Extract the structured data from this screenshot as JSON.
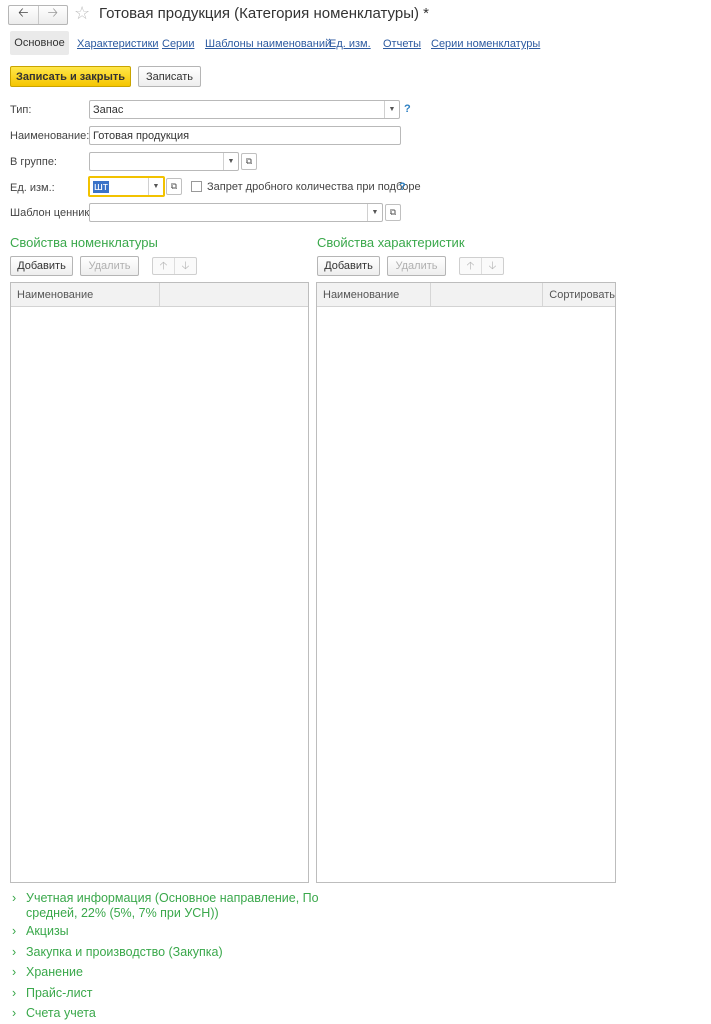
{
  "window": {
    "title": "Готовая продукция (Категория номенклатуры) *",
    "back_icon": "arrow-left",
    "forward_icon": "arrow-right",
    "favorite_icon": "star-outline"
  },
  "tabs": {
    "active": "Основное",
    "items": [
      "Характеристики",
      "Серии",
      "Шаблоны наименований",
      "Ед. изм.",
      "Отчеты",
      "Серии номенклатуры"
    ]
  },
  "toolbar": {
    "save_close_label": "Записать и закрыть",
    "save_label": "Записать"
  },
  "form": {
    "type_label": "Тип:",
    "type_value": "Запас",
    "name_label": "Наименование:",
    "name_value": "Готовая продукция",
    "group_label": "В группе:",
    "group_value": "",
    "unit_label": "Ед. изм.:",
    "unit_value": "шт",
    "fraction_checkbox_label": "Запрет дробного количества при подборе",
    "fraction_checked": false,
    "price_template_label": "Шаблон ценника:",
    "price_template_value": "",
    "help_mark": "?"
  },
  "nomenclature_props": {
    "title": "Свойства номенклатуры",
    "add_label": "Добавить",
    "delete_label": "Удалить",
    "columns": [
      "Наименование",
      ""
    ]
  },
  "characteristic_props": {
    "title": "Свойства характеристик",
    "add_label": "Добавить",
    "delete_label": "Удалить",
    "columns": [
      "Наименование",
      "",
      "Сортировать"
    ]
  },
  "groups": {
    "accounting_line1": "Учетная информация (Основное направление, По",
    "accounting_line2": "средней, 22% (5%, 7% при УСН))",
    "excise": "Акцизы",
    "purchase": "Закупка и производство (Закупка)",
    "storage": "Хранение",
    "price_list": "Прайс-лист",
    "accounts": "Счета учета"
  },
  "colors": {
    "accent_green": "#3aa84b",
    "link_blue": "#2c5aa0",
    "primary_yellow": "#f5c500",
    "focus_yellow": "#f2c200"
  }
}
